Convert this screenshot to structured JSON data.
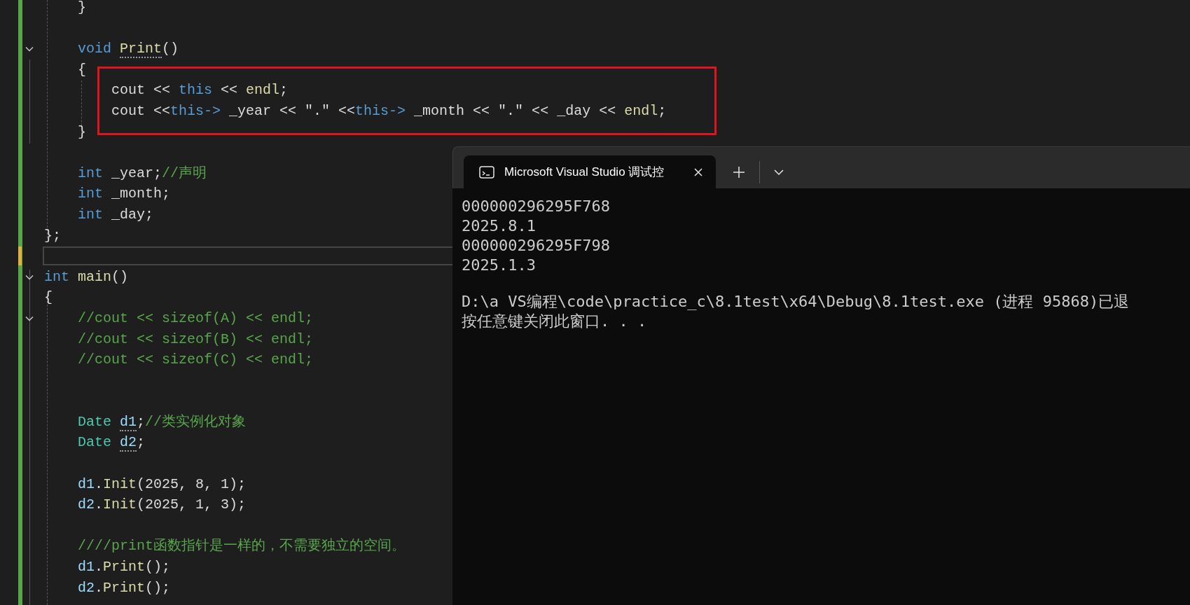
{
  "editor": {
    "lines": [
      {
        "kind": "code",
        "tokens": [
          {
            "text": "    }",
            "kind": "plain"
          }
        ]
      },
      {
        "kind": "blank"
      },
      {
        "kind": "code",
        "expanded": true,
        "tokens": [
          {
            "text": "    void ",
            "kind": "keyword"
          },
          {
            "text": "Print",
            "kind": "function",
            "hint": true
          },
          {
            "text": "()",
            "kind": "plain"
          }
        ]
      },
      {
        "kind": "code",
        "tokens": [
          {
            "text": "    {",
            "kind": "plain"
          }
        ]
      },
      {
        "kind": "code",
        "boxed": true,
        "tokens": [
          {
            "text": "        cout << ",
            "kind": "plain"
          },
          {
            "text": "this",
            "kind": "keyword"
          },
          {
            "text": " << ",
            "kind": "plain"
          },
          {
            "text": "endl",
            "kind": "function"
          },
          {
            "text": ";",
            "kind": "plain"
          }
        ]
      },
      {
        "kind": "code",
        "boxed": true,
        "tokens": [
          {
            "text": "        cout <<",
            "kind": "plain"
          },
          {
            "text": "this->",
            "kind": "keyword"
          },
          {
            "text": " _year << \".\" <<",
            "kind": "plain"
          },
          {
            "text": "this->",
            "kind": "keyword"
          },
          {
            "text": " _month << \".\" << _day << ",
            "kind": "plain"
          },
          {
            "text": "endl",
            "kind": "function"
          },
          {
            "text": ";",
            "kind": "plain"
          }
        ]
      },
      {
        "kind": "code",
        "tokens": [
          {
            "text": "    }",
            "kind": "plain"
          }
        ]
      },
      {
        "kind": "blank"
      },
      {
        "kind": "code",
        "tokens": [
          {
            "text": "    int",
            "kind": "keyword"
          },
          {
            "text": " _year;",
            "kind": "plain"
          },
          {
            "text": "//声明",
            "kind": "comment"
          }
        ]
      },
      {
        "kind": "code",
        "tokens": [
          {
            "text": "    int",
            "kind": "keyword"
          },
          {
            "text": " _month;",
            "kind": "plain"
          }
        ]
      },
      {
        "kind": "code",
        "tokens": [
          {
            "text": "    int",
            "kind": "keyword"
          },
          {
            "text": " _day;",
            "kind": "plain"
          }
        ]
      },
      {
        "kind": "code",
        "tokens": [
          {
            "text": "};",
            "kind": "plain"
          }
        ]
      },
      {
        "kind": "blank",
        "current": true
      },
      {
        "kind": "code",
        "expanded": true,
        "tokens": [
          {
            "text": "int ",
            "kind": "keyword"
          },
          {
            "text": "main",
            "kind": "function"
          },
          {
            "text": "()",
            "kind": "plain"
          }
        ]
      },
      {
        "kind": "code",
        "tokens": [
          {
            "text": "{",
            "kind": "plain"
          }
        ]
      },
      {
        "kind": "code",
        "expanded": true,
        "tokens": [
          {
            "text": "    //cout << sizeof(A) << endl;",
            "kind": "comment"
          }
        ]
      },
      {
        "kind": "code",
        "tokens": [
          {
            "text": "    //cout << sizeof(B) << endl;",
            "kind": "comment"
          }
        ]
      },
      {
        "kind": "code",
        "tokens": [
          {
            "text": "    //cout << sizeof(C) << endl;",
            "kind": "comment"
          }
        ]
      },
      {
        "kind": "blank"
      },
      {
        "kind": "blank"
      },
      {
        "kind": "code",
        "tokens": [
          {
            "text": "    Date ",
            "kind": "type"
          },
          {
            "text": "d1",
            "kind": "variable",
            "hint": true
          },
          {
            "text": ";",
            "kind": "plain"
          },
          {
            "text": "//类实例化对象",
            "kind": "comment"
          }
        ]
      },
      {
        "kind": "code",
        "tokens": [
          {
            "text": "    Date ",
            "kind": "type"
          },
          {
            "text": "d2",
            "kind": "variable",
            "hint": true
          },
          {
            "text": ";",
            "kind": "plain"
          }
        ]
      },
      {
        "kind": "blank"
      },
      {
        "kind": "code",
        "tokens": [
          {
            "text": "    d1",
            "kind": "variable"
          },
          {
            "text": ".",
            "kind": "plain"
          },
          {
            "text": "Init",
            "kind": "function"
          },
          {
            "text": "(2025, 8, 1);",
            "kind": "plain"
          }
        ]
      },
      {
        "kind": "code",
        "tokens": [
          {
            "text": "    d2",
            "kind": "variable"
          },
          {
            "text": ".",
            "kind": "plain"
          },
          {
            "text": "Init",
            "kind": "function"
          },
          {
            "text": "(2025, 1, 3);",
            "kind": "plain"
          }
        ]
      },
      {
        "kind": "blank"
      },
      {
        "kind": "code",
        "tokens": [
          {
            "text": "    ////print函数指针是一样的，不需要独立的空间。",
            "kind": "comment"
          }
        ]
      },
      {
        "kind": "code",
        "tokens": [
          {
            "text": "    d1",
            "kind": "variable"
          },
          {
            "text": ".",
            "kind": "plain"
          },
          {
            "text": "Print",
            "kind": "function"
          },
          {
            "text": "();",
            "kind": "plain"
          }
        ]
      },
      {
        "kind": "code",
        "tokens": [
          {
            "text": "    d2",
            "kind": "variable"
          },
          {
            "text": ".",
            "kind": "plain"
          },
          {
            "text": "Print",
            "kind": "function"
          },
          {
            "text": "();",
            "kind": "plain"
          }
        ]
      }
    ]
  },
  "terminal": {
    "tabs": [
      {
        "title": "Microsoft Visual Studio 调试控",
        "selected": true
      }
    ],
    "output": [
      "000000296295F768",
      "2025.8.1",
      "000000296295F798",
      "2025.1.3"
    ],
    "messages": [
      "D:\\a VS编程\\code\\practice_c\\8.1test\\x64\\Debug\\8.1test.exe (进程 95868)已退",
      "按任意键关闭此窗口. . ."
    ]
  }
}
